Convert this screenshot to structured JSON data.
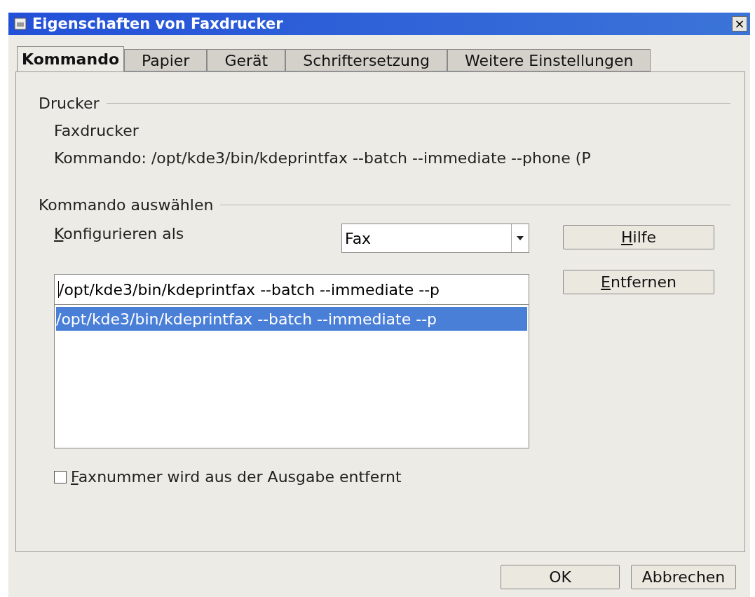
{
  "window": {
    "title": "Eigenschaften von Faxdrucker",
    "close": "×"
  },
  "tabs": [
    {
      "label": "Kommando",
      "selected": true
    },
    {
      "label": "Papier",
      "selected": false
    },
    {
      "label": "Gerät",
      "selected": false
    },
    {
      "label": "Schriftersetzung",
      "selected": false
    },
    {
      "label": "Weitere Einstellungen",
      "selected": false
    }
  ],
  "printer_group": {
    "title": "Drucker",
    "name": "Faxdrucker",
    "command": "Kommando: /opt/kde3/bin/kdeprintfax --batch --immediate --phone (P"
  },
  "command_group": {
    "title": "Kommando auswählen",
    "configure_label": {
      "text": "Konfigurieren als",
      "mnemonic": true
    },
    "configure_select": {
      "value": "Fax"
    },
    "command_input": {
      "value": "/opt/kde3/bin/kdeprintfax --batch --immediate --p"
    },
    "command_list": [
      {
        "text": "/opt/kde3/bin/kdeprintfax --batch --immediate --p",
        "selected": true
      }
    ],
    "side_buttons": [
      {
        "label": "Hilfe",
        "mnemonic": true
      },
      {
        "label": "Entfernen",
        "mnemonic": true
      }
    ],
    "fax_checkbox": {
      "label": "Faxnummer wird aus der Ausgabe entfernt",
      "mnemonic": true,
      "checked": false
    }
  },
  "buttons": [
    {
      "label": "OK",
      "mnemonic": false
    },
    {
      "label": "Abbrechen",
      "mnemonic": false
    }
  ]
}
